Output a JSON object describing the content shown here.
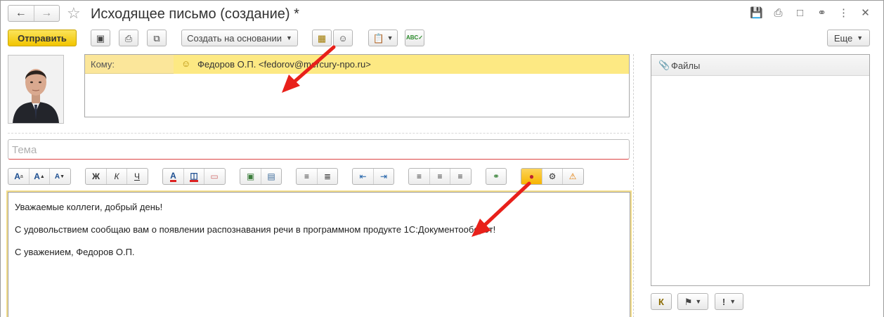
{
  "window": {
    "title": "Исходящее письмо (создание) *",
    "star_icon": "☆"
  },
  "toolbar": {
    "send_label": "Отправить",
    "create_based_label": "Создать на основании",
    "more_label": "Еще"
  },
  "recipients": {
    "to_label": "Кому:",
    "to_value": "Федоров О.П. <fedorov@mercury-npo.ru>"
  },
  "subject": {
    "placeholder": "Тема"
  },
  "format_toolbar": {
    "bold": "Ж",
    "italic": "К",
    "underline": "Ч"
  },
  "body": {
    "line1": "Уважаемые коллеги, добрый день!",
    "line2": "С удовольствием сообщаю вам о появлении распознавания  речи в программном продукте 1С:Документооборот!",
    "line3": "С уважением, Федоров О.П."
  },
  "files_panel": {
    "title": "Файлы",
    "k_button": "К"
  },
  "colors": {
    "accent_yellow": "#f2c500",
    "recipient_row": "#fbe69a",
    "arrow_red": "#e8201a",
    "mic_active": "#f7b500"
  }
}
